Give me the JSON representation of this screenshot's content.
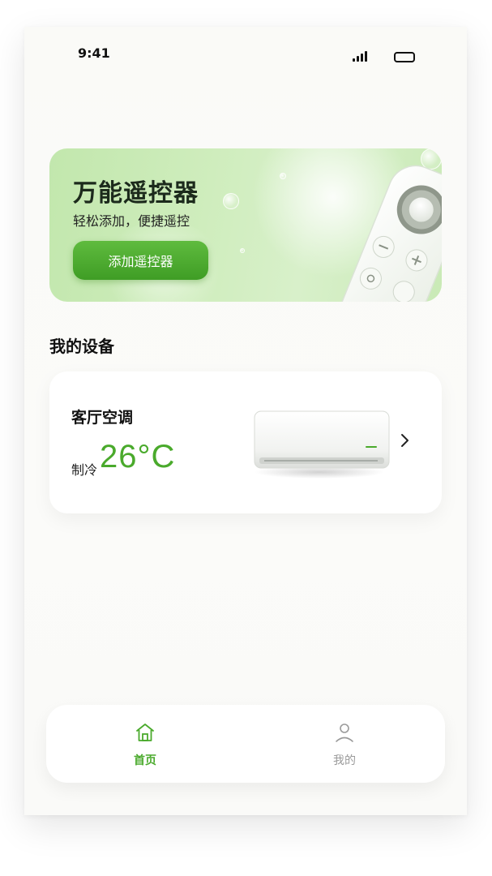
{
  "status_bar": {
    "time": "9:41"
  },
  "banner": {
    "title": "万能遥控器",
    "subtitle": "轻松添加，便捷遥控",
    "button_label": "添加遥控器"
  },
  "section": {
    "title": "我的设备"
  },
  "devices": [
    {
      "name": "客厅空调",
      "mode": "制冷",
      "temperature": "26°C"
    }
  ],
  "tabbar": {
    "items": [
      {
        "label": "首页",
        "icon": "home-icon",
        "active": true
      },
      {
        "label": "我的",
        "icon": "user-icon",
        "active": false
      }
    ]
  },
  "colors": {
    "accent": "#4aaa2c",
    "button": "#4fae32",
    "banner_bg": "#cdecbb",
    "inactive": "#9a9a9a"
  }
}
